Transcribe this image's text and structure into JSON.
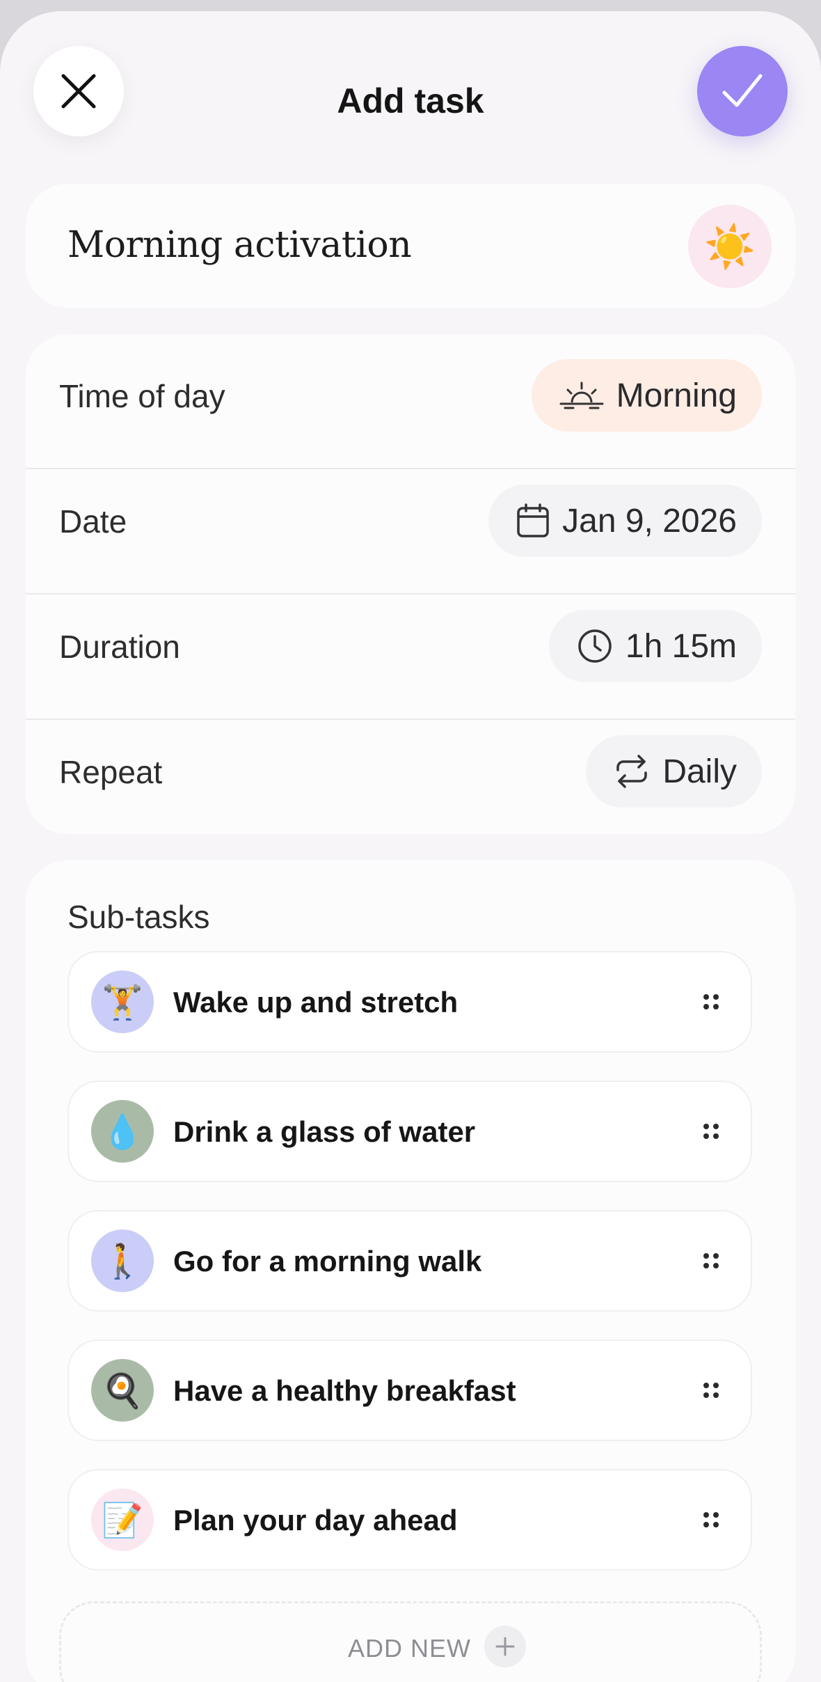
{
  "header": {
    "title": "Add task",
    "close_icon": "close-icon",
    "confirm_icon": "checkmark-icon",
    "accent_color": "#9b86f3"
  },
  "task": {
    "name": "Morning activation",
    "emoji": "☀️"
  },
  "properties": [
    {
      "label": "Time of day",
      "value": "Morning",
      "icon": "sunrise-icon"
    },
    {
      "label": "Date",
      "value": "Jan 9, 2026",
      "icon": "calendar-icon"
    },
    {
      "label": "Duration",
      "value": "1h 15m",
      "icon": "clock-icon"
    },
    {
      "label": "Repeat",
      "value": "Daily",
      "icon": "repeat-icon"
    }
  ],
  "subtasks": {
    "heading": "Sub-tasks",
    "items": [
      {
        "label": "Wake up and stretch",
        "emoji": "🏋️",
        "bg": "#c9cdf7"
      },
      {
        "label": "Drink a glass of water",
        "emoji": "💧",
        "bg": "#a9bba6"
      },
      {
        "label": "Go for a morning walk",
        "emoji": "🚶",
        "bg": "#c9cdf7"
      },
      {
        "label": "Have a healthy breakfast",
        "emoji": "🍳",
        "bg": "#a9bba6"
      },
      {
        "label": "Plan your day ahead",
        "emoji": "📝",
        "bg": "#fbe7ef"
      }
    ],
    "add_new_label": "ADD NEW"
  }
}
